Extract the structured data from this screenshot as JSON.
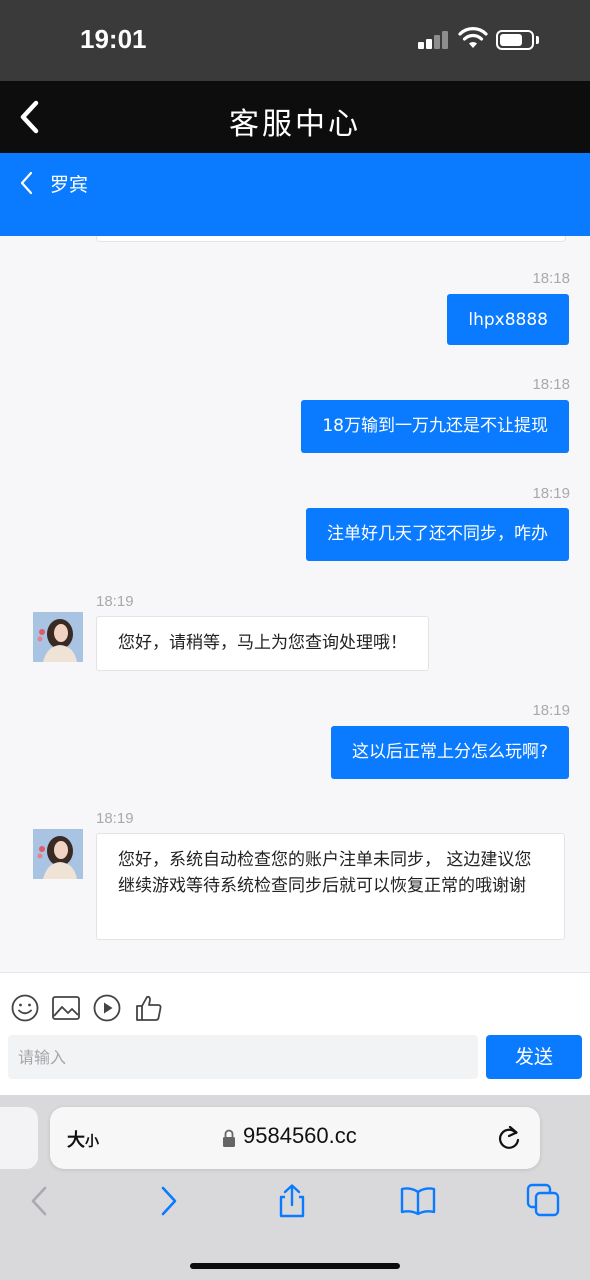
{
  "status_bar": {
    "time": "19:01"
  },
  "nav": {
    "title": "客服中心"
  },
  "chat": {
    "contact_name": "罗宾",
    "messages": [
      {
        "direction": "out",
        "time": "18:18",
        "text": "lhpx8888"
      },
      {
        "direction": "out",
        "time": "18:18",
        "text": "18万输到一万九还是不让提现"
      },
      {
        "direction": "out",
        "time": "18:19",
        "text": "注单好几天了还不同步，咋办"
      },
      {
        "direction": "in",
        "time": "18:19",
        "text": "您好，请稍等，马上为您查询处理哦！"
      },
      {
        "direction": "out",
        "time": "18:19",
        "text": "这以后正常上分怎么玩啊?"
      },
      {
        "direction": "in",
        "time": "18:19",
        "text": "您好，系统自动检查您的账户注单未同步， 这边建议您继续游戏等待系统检查同步后就可以恢复正常的哦谢谢"
      }
    ]
  },
  "composer": {
    "placeholder": "请输入",
    "value": "",
    "send_label": "发送",
    "tools": [
      "emoji-icon",
      "image-icon",
      "video-play-icon",
      "thumbs-up-icon"
    ]
  },
  "browser": {
    "text_size_label_big": "大",
    "text_size_label_small": "小",
    "url": "9584560.cc",
    "toolbar": [
      "back-arrow-icon",
      "forward-arrow-icon",
      "share-icon",
      "bookmarks-icon",
      "tabs-icon"
    ]
  },
  "colors": {
    "accent": "#0a7bff",
    "nav_bg": "#0d0d0d",
    "status_bg": "#3a3a3a",
    "chat_bg": "#f7f7f9"
  }
}
